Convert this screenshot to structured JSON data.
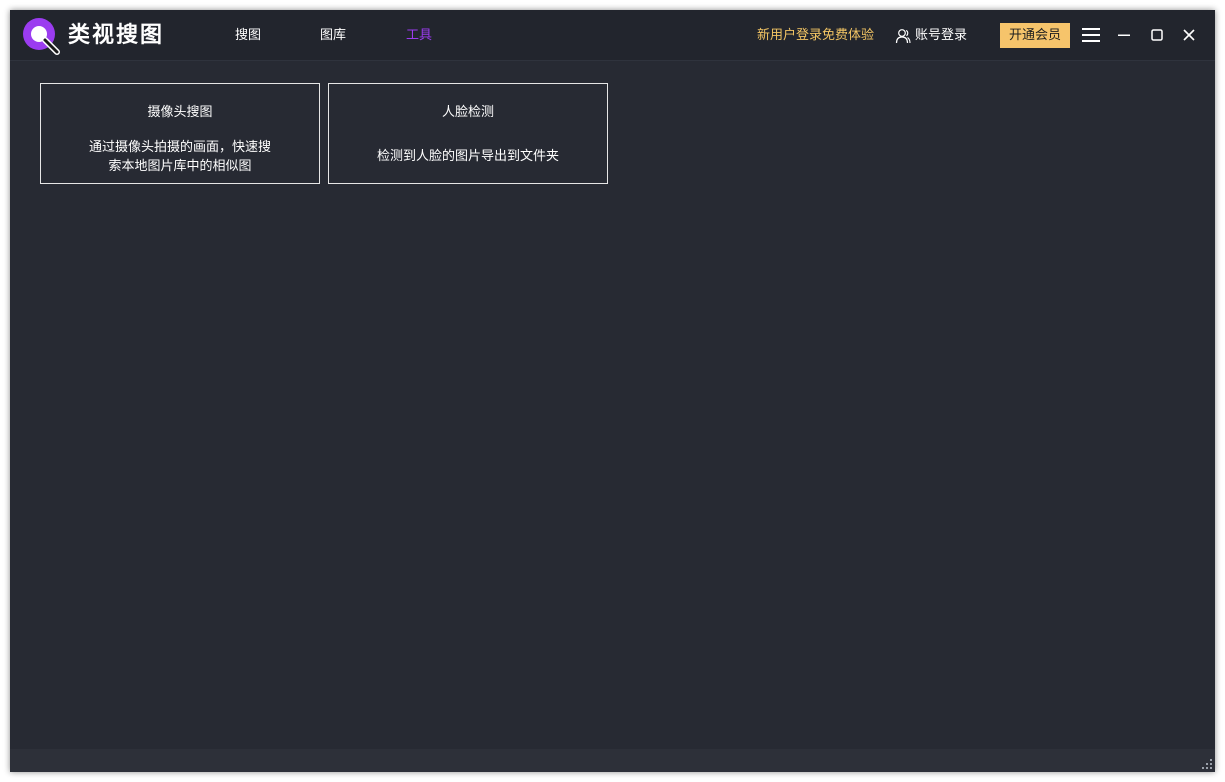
{
  "app": {
    "title": "类视搜图",
    "logo_icon": "magnifier-logo-icon",
    "accent_color": "#9b3cf0"
  },
  "nav": {
    "tabs": [
      {
        "label": "搜图",
        "active": false
      },
      {
        "label": "图库",
        "active": false
      },
      {
        "label": "工具",
        "active": true
      }
    ]
  },
  "header": {
    "promo_text": "新用户登录免费体验",
    "login_label": "账号登录",
    "login_icon": "user-icon",
    "vip_button_label": "开通会员",
    "vip_color": "#f6c46b",
    "menu_icon": "hamburger-menu-icon",
    "window_controls": [
      "minimize-icon",
      "maximize-icon",
      "close-icon"
    ]
  },
  "tools": [
    {
      "title": "摄像头搜图",
      "description": "通过摄像头拍摄的画面，快速搜索本地图片库中的相似图"
    },
    {
      "title": "人脸检测",
      "description": "检测到人脸的图片导出到文件夹"
    }
  ],
  "statusbar": {
    "grip_icon": "resize-grip-icon"
  }
}
